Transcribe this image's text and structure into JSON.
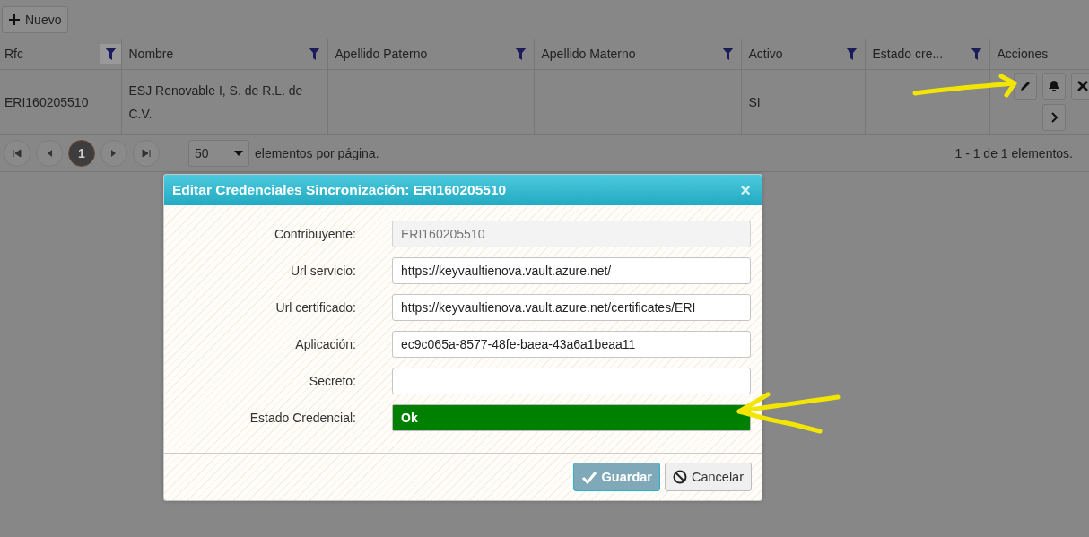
{
  "toolbar": {
    "new_button": "Nuevo"
  },
  "table": {
    "columns": [
      {
        "label": "Rfc",
        "filter": true
      },
      {
        "label": "Nombre",
        "filter": true
      },
      {
        "label": "Apellido Paterno",
        "filter": true
      },
      {
        "label": "Apellido Materno",
        "filter": true
      },
      {
        "label": "Activo",
        "filter": true
      },
      {
        "label": "Estado cre...",
        "filter": true
      },
      {
        "label": "Acciones",
        "filter": false
      }
    ],
    "rows": [
      {
        "cells": [
          "ERI160205510",
          "ESJ Renovable I, S. de R.L. de C.V.",
          null,
          null,
          "SI",
          null
        ]
      }
    ]
  },
  "pager": {
    "pages": [
      {
        "label": "1",
        "selected": true
      }
    ],
    "page_size": "50",
    "page_size_label": "elementos por página.",
    "info": "1 - 1 de 1 elementos."
  },
  "dialog": {
    "title": "Editar Credenciales Sincronización: ERI160205510",
    "close": "×",
    "fields": [
      {
        "label": "Contribuyente:",
        "value": "ERI160205510",
        "kind": "text",
        "disabled": true
      },
      {
        "label": "Url servicio:",
        "value": "https://keyvaultienova.vault.azure.net/",
        "kind": "text",
        "disabled": false
      },
      {
        "label": "Url certificado:",
        "value": "https://keyvaultienova.vault.azure.net/certificates/ERI",
        "kind": "text",
        "disabled": false
      },
      {
        "label": "Aplicación:",
        "value": "ec9c065a-8577-48fe-baea-43a6a1beaa11",
        "kind": "text",
        "disabled": false
      },
      {
        "label": "Secreto:",
        "kind": "text",
        "disabled": false
      },
      {
        "label": "Estado Credencial:",
        "value": "Ok",
        "kind": "status",
        "color": "#008000"
      }
    ],
    "buttons": [
      {
        "label": "Guardar",
        "kind": "primary"
      },
      {
        "label": "Cancelar",
        "kind": "cancel"
      }
    ]
  }
}
